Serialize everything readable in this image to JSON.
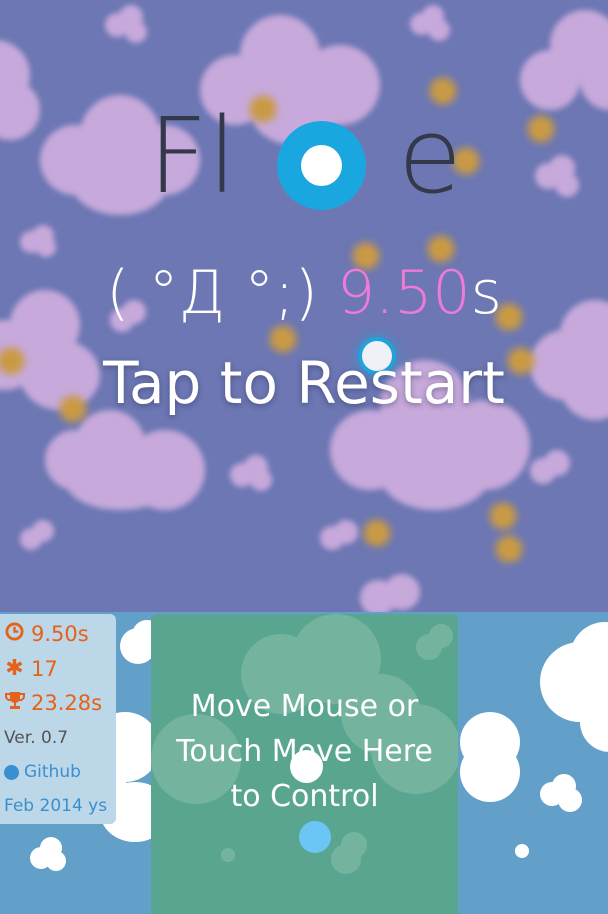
{
  "game": {
    "title_left": "Fl",
    "title_right": "e",
    "face": "( °Д °;)",
    "time": "9.50",
    "time_unit": "s",
    "restart": "Tap to Restart"
  },
  "control": {
    "instruction_line1": "Move Mouse or",
    "instruction_line2": "Touch Move Here",
    "instruction_line3": "to Control"
  },
  "stats": {
    "time": "9.50s",
    "stars": "17",
    "best": "23.28s",
    "version": "Ver. 0.7",
    "github": "Github",
    "date": "Feb 2014 ys"
  },
  "icons": {
    "time": "clock-icon",
    "stars": "asterisk-icon",
    "best": "trophy-icon",
    "github": "github-icon"
  },
  "colors": {
    "sky": "#6c77b3",
    "cloud": "#c7a9db",
    "logo_blue": "#1aa7e0",
    "score_pink": "#f07ad8",
    "stat_orange": "#e4621b",
    "pad_green": "#5aa58f",
    "control_blue": "#62a0c9"
  }
}
